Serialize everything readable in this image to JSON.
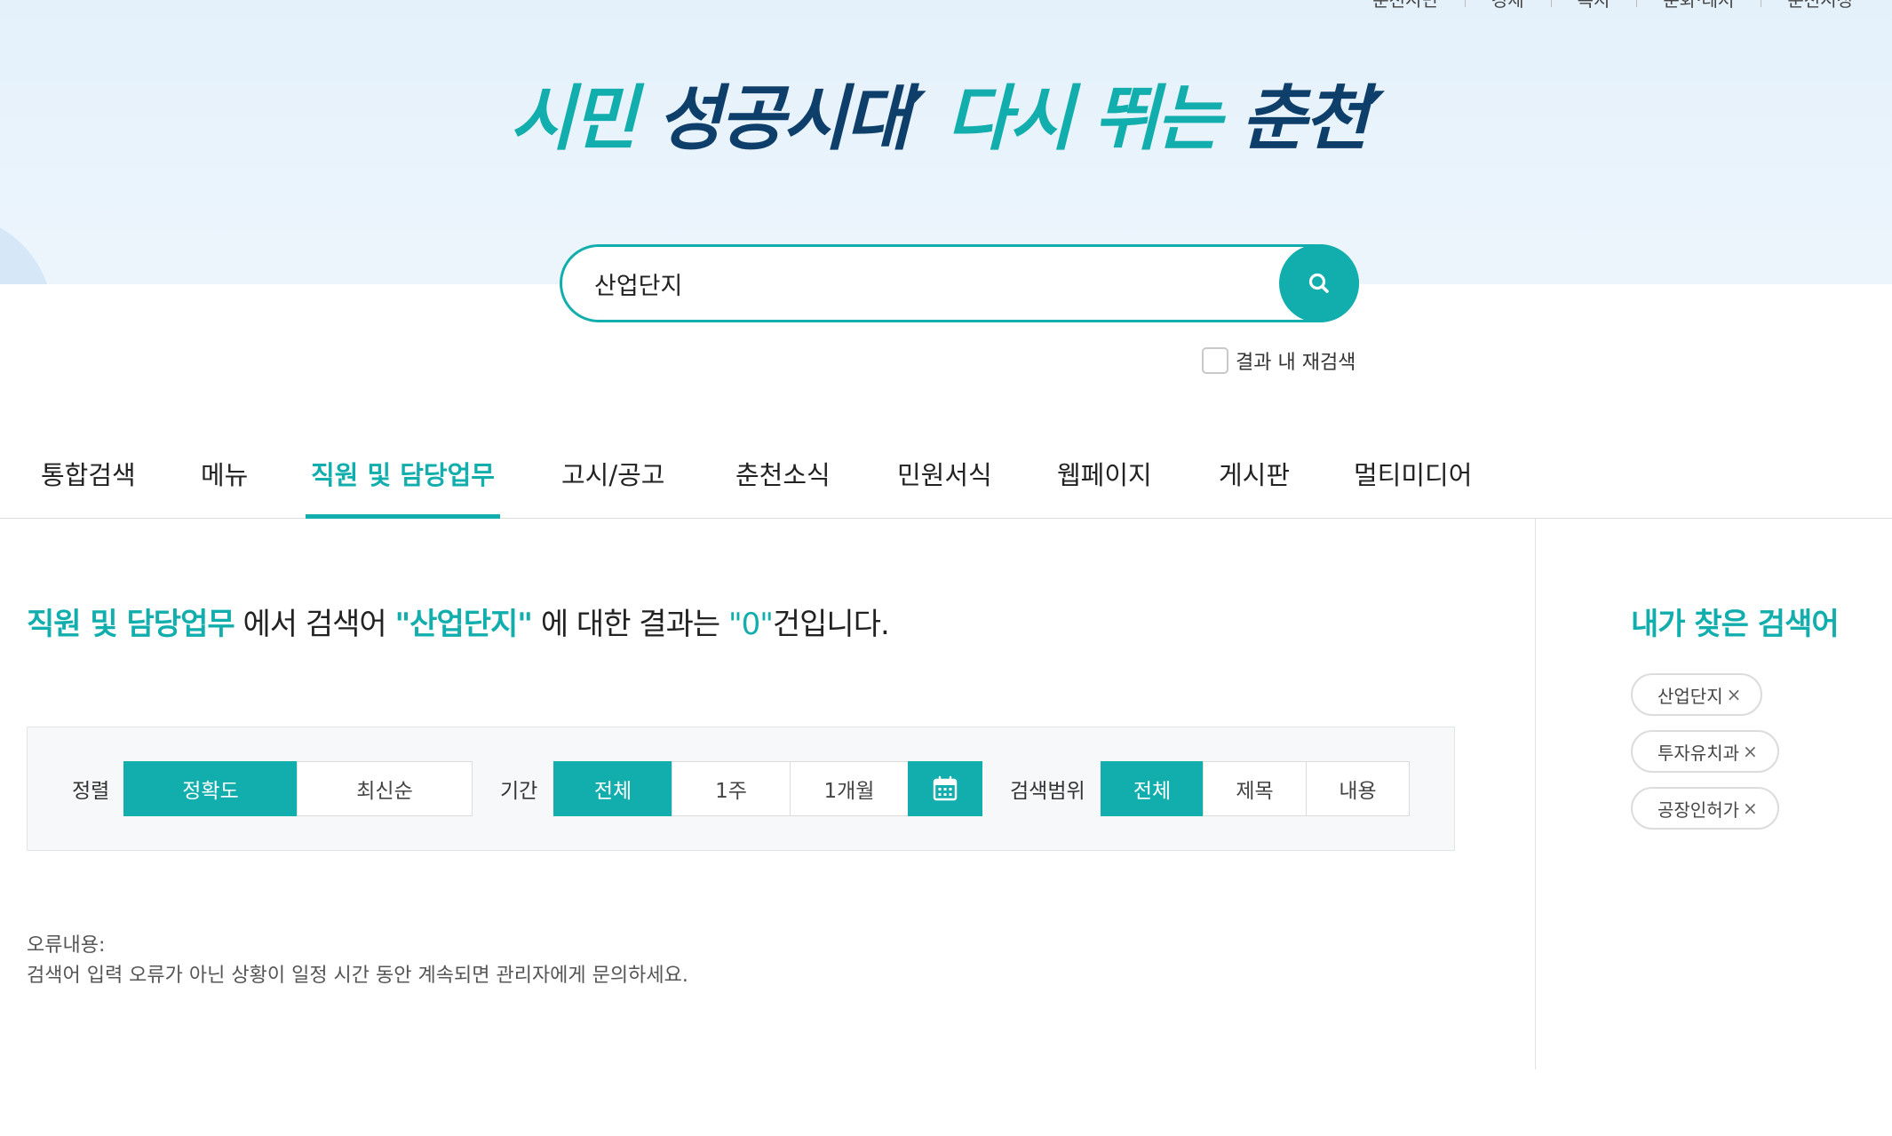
{
  "top_nav": [
    "춘천시민",
    "경제",
    "복지",
    "문화·레저",
    "춘천시청"
  ],
  "slogan": {
    "part1": "시민",
    "part2": "성공시대",
    "mark1": "′",
    "part3": "다시 뛰는",
    "part4": "춘천",
    "mark2": "′"
  },
  "search": {
    "value": "산업단지",
    "research_label": "결과 내 재검색"
  },
  "tabs": [
    "통합검색",
    "메뉴",
    "직원 및 담당업무",
    "고시/공고",
    "춘천소식",
    "민원서식",
    "웹페이지",
    "게시판",
    "멀티미디어"
  ],
  "active_tab": "직원 및 담당업무",
  "result": {
    "category": "직원 및 담당업무",
    "mid1": " 에서 검색어 ",
    "query": "\"산업단지\"",
    "mid2": " 에 대한 결과는 ",
    "count": "\"0\"",
    "tail": "건입니다."
  },
  "filters": {
    "sort_label": "정렬",
    "sort_options": [
      "정확도",
      "최신순"
    ],
    "period_label": "기간",
    "period_options": [
      "전체",
      "1주",
      "1개월"
    ],
    "scope_label": "검색범위",
    "scope_options": [
      "전체",
      "제목",
      "내용"
    ]
  },
  "error": {
    "title": "오류내용:",
    "message": "검색어 입력 오류가 아닌 상황이 일정 시간 동안 계속되면 관리자에게 문의하세요."
  },
  "sidebar": {
    "title": "내가 찾은 검색어",
    "recent": [
      "산업단지",
      "투자유치과",
      "공장인허가"
    ],
    "remove_symbol": "×"
  },
  "colors": {
    "accent": "#12aeae",
    "navy": "#0e3f6b",
    "hero_bg": "#e4f1fb"
  }
}
